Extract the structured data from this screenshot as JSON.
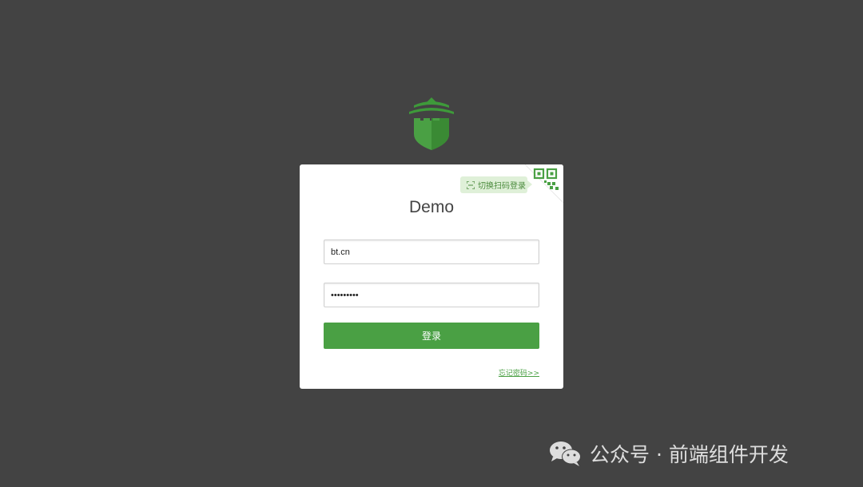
{
  "logo": {
    "icon": "castle-shield-logo",
    "color": "#4aa044"
  },
  "login": {
    "title": "Demo",
    "qr_switch_label": "切换扫码登录",
    "username_value": "bt.cn",
    "password_value": "•••••••••",
    "submit_label": "登录",
    "forgot_label": "忘记密码>>"
  },
  "watermark": {
    "text": "公众号 · 前端组件开发",
    "icon": "wechat-icon"
  },
  "colors": {
    "background": "#434343",
    "accent": "#4aa044",
    "card": "#ffffff"
  }
}
